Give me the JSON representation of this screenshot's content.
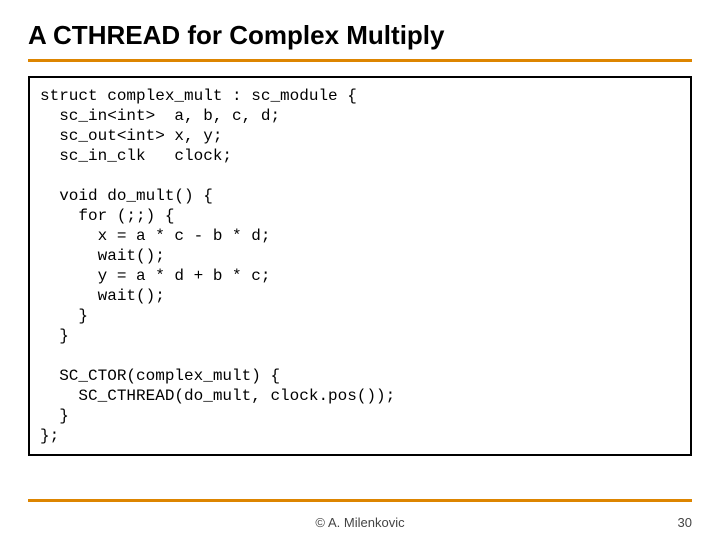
{
  "title": "A CTHREAD for Complex Multiply",
  "code": "struct complex_mult : sc_module {\n  sc_in<int>  a, b, c, d;\n  sc_out<int> x, y;\n  sc_in_clk   clock;\n\n  void do_mult() {\n    for (;;) {\n      x = a * c - b * d;\n      wait();\n      y = a * d + b * c;\n      wait();\n    }\n  }\n\n  SC_CTOR(complex_mult) {\n    SC_CTHREAD(do_mult, clock.pos());\n  }\n};",
  "footer": {
    "copyright_symbol": "©",
    "author": "A. Milenkovic",
    "page": "30"
  }
}
